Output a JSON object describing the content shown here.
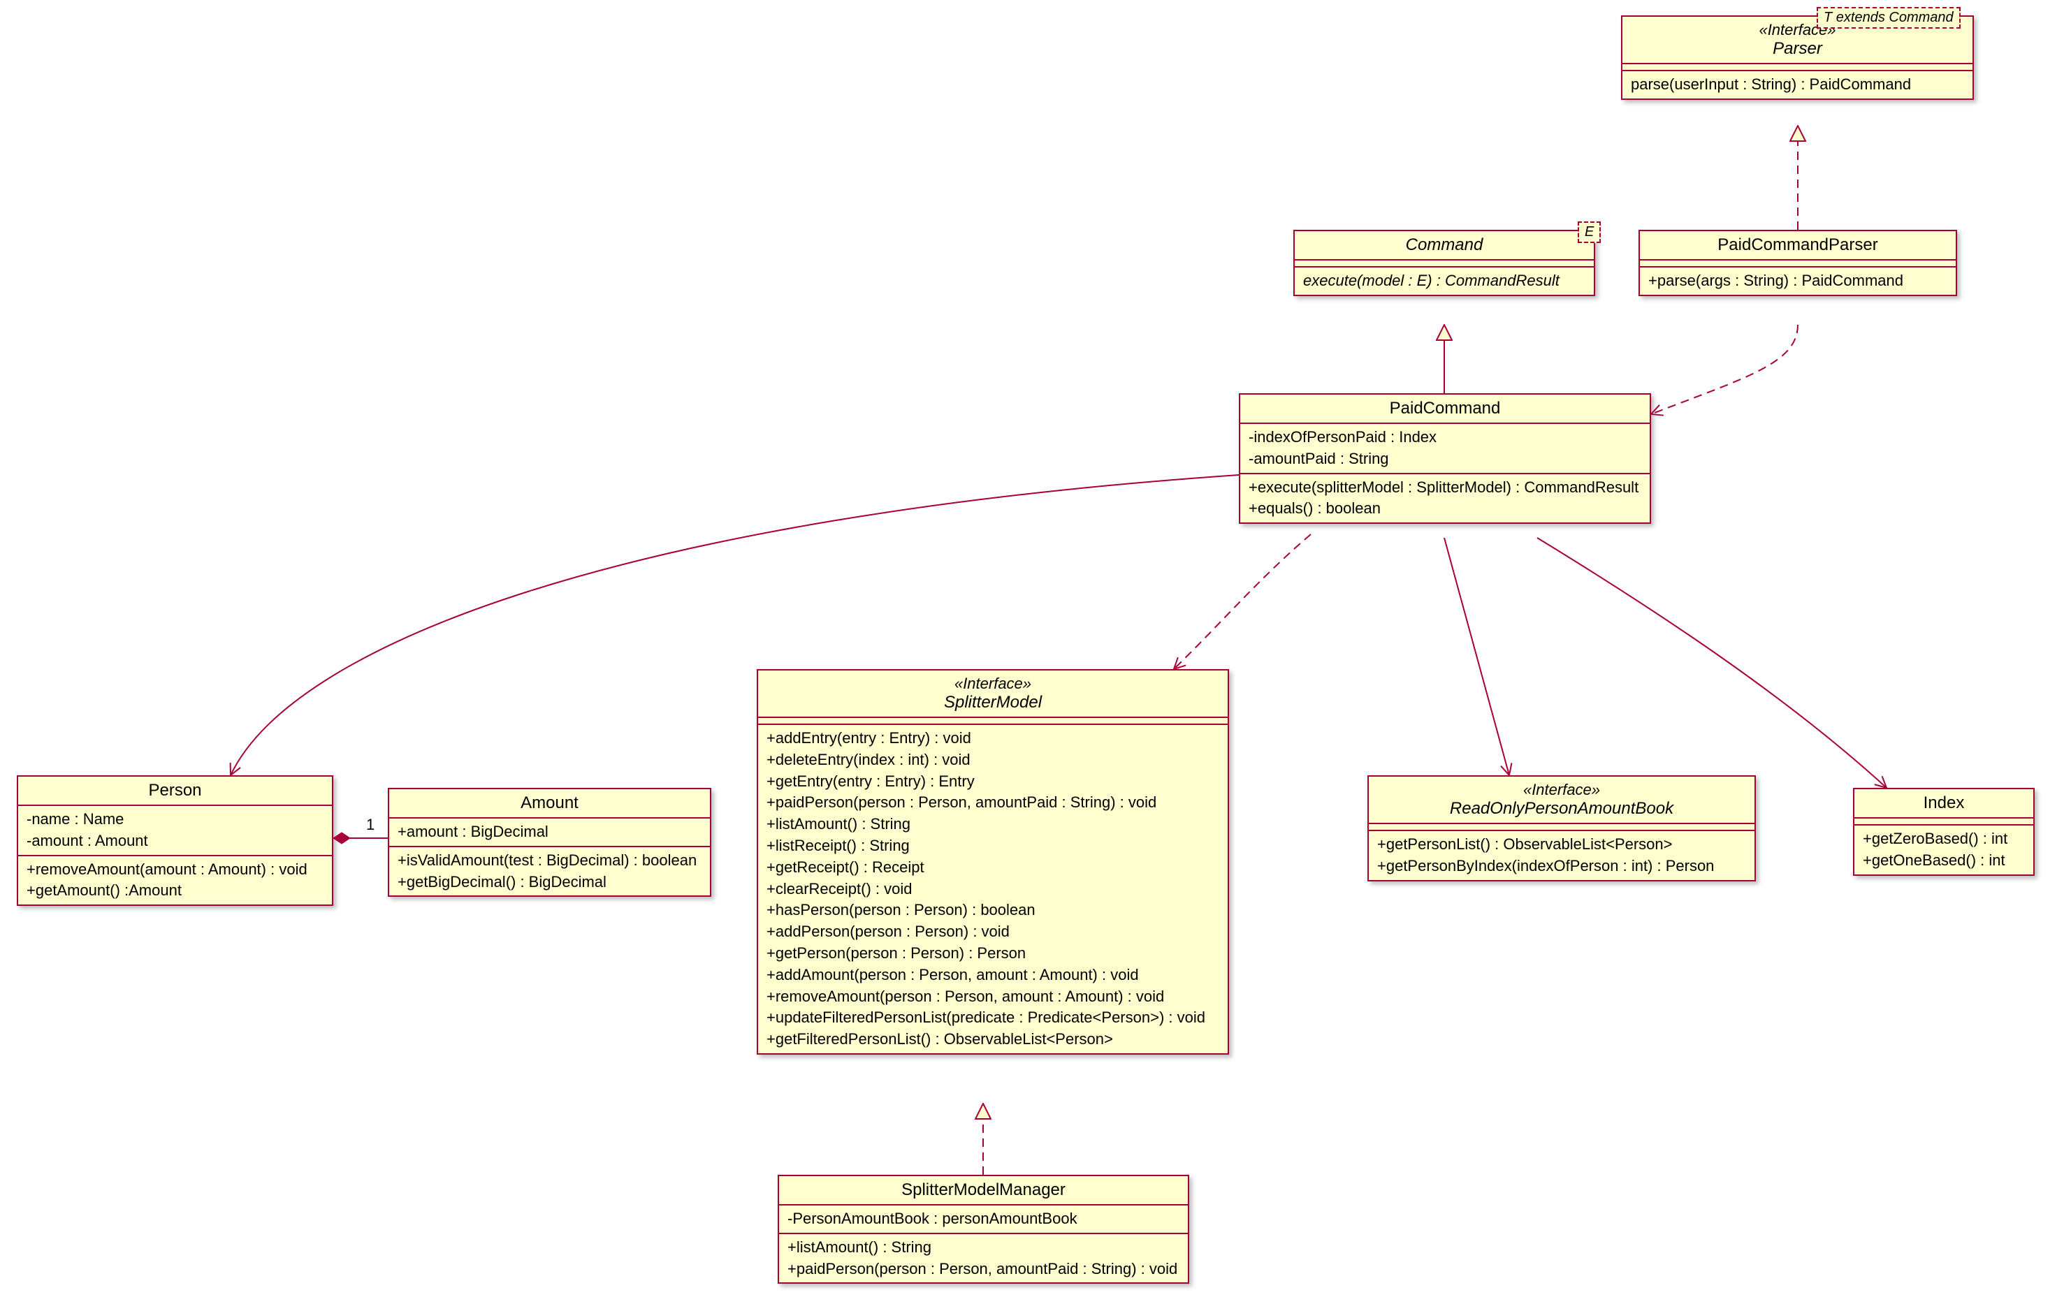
{
  "colors": {
    "border": "#a80036",
    "fill": "#fefece"
  },
  "classes": {
    "parser": {
      "stereo": "«Interface»",
      "name": "Parser",
      "template": "T extends Command",
      "ops": [
        "parse(userInput : String) : PaidCommand"
      ]
    },
    "command": {
      "name": "Command",
      "template": "E",
      "ops": [
        "execute(model : E) : CommandResult"
      ]
    },
    "paidCommandParser": {
      "name": "PaidCommandParser",
      "ops": [
        "+parse(args : String) : PaidCommand"
      ]
    },
    "paidCommand": {
      "name": "PaidCommand",
      "attrs": [
        "-indexOfPersonPaid : Index",
        "-amountPaid : String"
      ],
      "ops": [
        "+execute(splitterModel : SplitterModel) : CommandResult",
        "+equals() : boolean"
      ]
    },
    "person": {
      "name": "Person",
      "attrs": [
        "-name : Name",
        "-amount : Amount"
      ],
      "ops": [
        "+removeAmount(amount : Amount) : void",
        "+getAmount() :Amount"
      ]
    },
    "amount": {
      "name": "Amount",
      "attrs": [
        "+amount : BigDecimal"
      ],
      "ops": [
        "+isValidAmount(test : BigDecimal) : boolean",
        "+getBigDecimal() : BigDecimal"
      ]
    },
    "splitterModel": {
      "stereo": "«Interface»",
      "name": "SplitterModel",
      "ops": [
        "+addEntry(entry : Entry) : void",
        "+deleteEntry(index : int) : void",
        "+getEntry(entry : Entry) : Entry",
        "+paidPerson(person : Person, amountPaid : String) : void",
        "+listAmount() : String",
        "+listReceipt() : String",
        "+getReceipt() : Receipt",
        "+clearReceipt() : void",
        "+hasPerson(person : Person) : boolean",
        "+addPerson(person : Person) : void",
        "+getPerson(person : Person) : Person",
        "+addAmount(person : Person, amount : Amount) : void",
        "+removeAmount(person : Person, amount : Amount) : void",
        "+updateFilteredPersonList(predicate : Predicate<Person>) : void",
        "+getFilteredPersonList() : ObservableList<Person>"
      ]
    },
    "roab": {
      "stereo": "«Interface»",
      "name": "ReadOnlyPersonAmountBook",
      "ops": [
        "+getPersonList() : ObservableList<Person>",
        "+getPersonByIndex(indexOfPerson : int) : Person"
      ]
    },
    "index": {
      "name": "Index",
      "ops": [
        "+getZeroBased() : int",
        "+getOneBased() : int"
      ]
    },
    "smm": {
      "name": "SplitterModelManager",
      "attrs": [
        "-PersonAmountBook : personAmountBook"
      ],
      "ops": [
        "+listAmount() : String",
        "+paidPerson(person : Person, amountPaid : String) : void"
      ]
    }
  },
  "multiplicities": {
    "personAmount": "1"
  },
  "chart_data": {
    "type": "uml-class",
    "classes": [
      {
        "name": "Parser",
        "stereotype": "Interface",
        "template": "T extends Command",
        "operations": [
          "parse(userInput : String) : PaidCommand"
        ]
      },
      {
        "name": "Command",
        "abstract": true,
        "template": "E",
        "operations": [
          "execute(model : E) : CommandResult"
        ],
        "abstract_operations": [
          "execute(model : E) : CommandResult"
        ]
      },
      {
        "name": "PaidCommandParser",
        "operations": [
          "+parse(args : String) : PaidCommand"
        ]
      },
      {
        "name": "PaidCommand",
        "attributes": [
          "-indexOfPersonPaid : Index",
          "-amountPaid : String"
        ],
        "operations": [
          "+execute(splitterModel : SplitterModel) : CommandResult",
          "+equals() : boolean"
        ]
      },
      {
        "name": "Person",
        "attributes": [
          "-name : Name",
          "-amount : Amount"
        ],
        "operations": [
          "+removeAmount(amount : Amount) : void",
          "+getAmount() :Amount"
        ]
      },
      {
        "name": "Amount",
        "attributes": [
          "+amount : BigDecimal"
        ],
        "operations": [
          "+isValidAmount(test : BigDecimal) : boolean",
          "+getBigDecimal() : BigDecimal"
        ]
      },
      {
        "name": "SplitterModel",
        "stereotype": "Interface",
        "operations": [
          "+addEntry(entry : Entry) : void",
          "+deleteEntry(index : int) : void",
          "+getEntry(entry : Entry) : Entry",
          "+paidPerson(person : Person, amountPaid : String) : void",
          "+listAmount() : String",
          "+listReceipt() : String",
          "+getReceipt() : Receipt",
          "+clearReceipt() : void",
          "+hasPerson(person : Person) : boolean",
          "+addPerson(person : Person) : void",
          "+getPerson(person : Person) : Person",
          "+addAmount(person : Person, amount : Amount) : void",
          "+removeAmount(person : Person, amount : Amount) : void",
          "+updateFilteredPersonList(predicate : Predicate<Person>) : void",
          "+getFilteredPersonList() : ObservableList<Person>"
        ]
      },
      {
        "name": "ReadOnlyPersonAmountBook",
        "stereotype": "Interface",
        "operations": [
          "+getPersonList() : ObservableList<Person>",
          "+getPersonByIndex(indexOfPerson : int) : Person"
        ]
      },
      {
        "name": "Index",
        "operations": [
          "+getZeroBased() : int",
          "+getOneBased() : int"
        ]
      },
      {
        "name": "SplitterModelManager",
        "attributes": [
          "-PersonAmountBook : personAmountBook"
        ],
        "operations": [
          "+listAmount() : String",
          "+paidPerson(person : Person, amountPaid : String) : void"
        ]
      }
    ],
    "relations": [
      {
        "from": "PaidCommandParser",
        "to": "Parser",
        "type": "realization"
      },
      {
        "from": "PaidCommand",
        "to": "Command",
        "type": "generalization"
      },
      {
        "from": "PaidCommandParser",
        "to": "PaidCommand",
        "type": "dependency"
      },
      {
        "from": "PaidCommand",
        "to": "SplitterModel",
        "type": "dependency"
      },
      {
        "from": "PaidCommand",
        "to": "Person",
        "type": "association"
      },
      {
        "from": "PaidCommand",
        "to": "ReadOnlyPersonAmountBook",
        "type": "association"
      },
      {
        "from": "PaidCommand",
        "to": "Index",
        "type": "association"
      },
      {
        "from": "SplitterModelManager",
        "to": "SplitterModel",
        "type": "realization"
      },
      {
        "from": "Person",
        "to": "Amount",
        "type": "composition",
        "multiplicity_to": "1"
      }
    ]
  }
}
